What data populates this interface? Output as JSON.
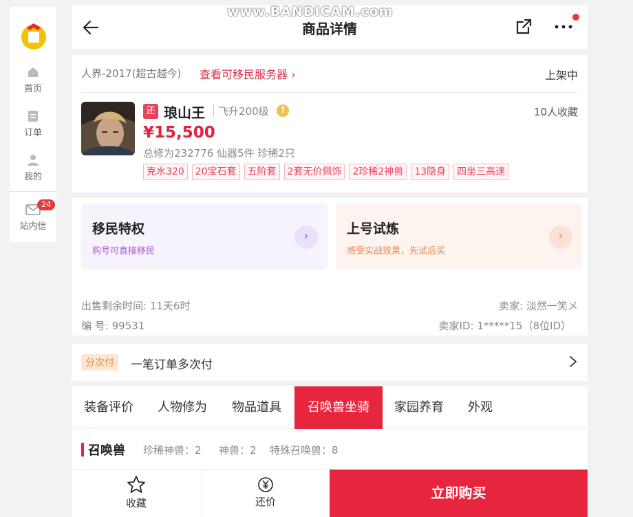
{
  "overlay": {
    "recorder_watermark": "www.BANDICAM.com"
  },
  "sidebar": {
    "items": [
      {
        "label": "首页",
        "icon": "home-icon"
      },
      {
        "label": "订单",
        "icon": "order-icon"
      },
      {
        "label": "我的",
        "icon": "user-icon"
      },
      {
        "label": "站内信",
        "icon": "mail-icon",
        "badge": "24"
      }
    ]
  },
  "nav": {
    "title": "商品详情"
  },
  "product": {
    "server": "人界-2017(超古越今)",
    "server_link": "查看可移民服务器",
    "status": "上架中",
    "type_tag": "还",
    "name": "琅山王",
    "level": "飞升200级",
    "favorites": "10人收藏",
    "price": "¥15,500",
    "summary": "总修为232776  仙器5件  珍稀2只",
    "tags": [
      "克水320",
      "20宝石套",
      "五阶套",
      "2套无价佩饰",
      "2珍稀2神兽",
      "13隐身",
      "四坐三高速"
    ]
  },
  "privileges": {
    "migrate": {
      "title": "移民特权",
      "subtitle": "购号可直接移民"
    },
    "trial": {
      "title": "上号试炼",
      "subtitle": "感受实战效果，先试后买"
    }
  },
  "sale_info": {
    "remaining": "出售剩余时间: 11天6时",
    "seller": "卖家: 淡然一笑メ",
    "serial": "编  号: 99531",
    "seller_id": "卖家ID: 1*****15（8位ID）"
  },
  "installment": {
    "tag": "分次付",
    "text": "一笔订单多次付"
  },
  "tabs": [
    {
      "label": "装备评价"
    },
    {
      "label": "人物修为"
    },
    {
      "label": "物品道具"
    },
    {
      "label": "召唤兽坐骑",
      "active": true
    },
    {
      "label": "家园养育"
    },
    {
      "label": "外观"
    }
  ],
  "section": {
    "title": "召唤兽",
    "stats": [
      "珍稀神兽：2",
      "神兽：2",
      "特殊召唤兽：8"
    ]
  },
  "bottom": {
    "favorite": "收藏",
    "bargain": "还价",
    "buy": "立即购买"
  },
  "colors": {
    "accent": "#e8253e",
    "price": "#e3223c",
    "link": "#d9304a"
  }
}
